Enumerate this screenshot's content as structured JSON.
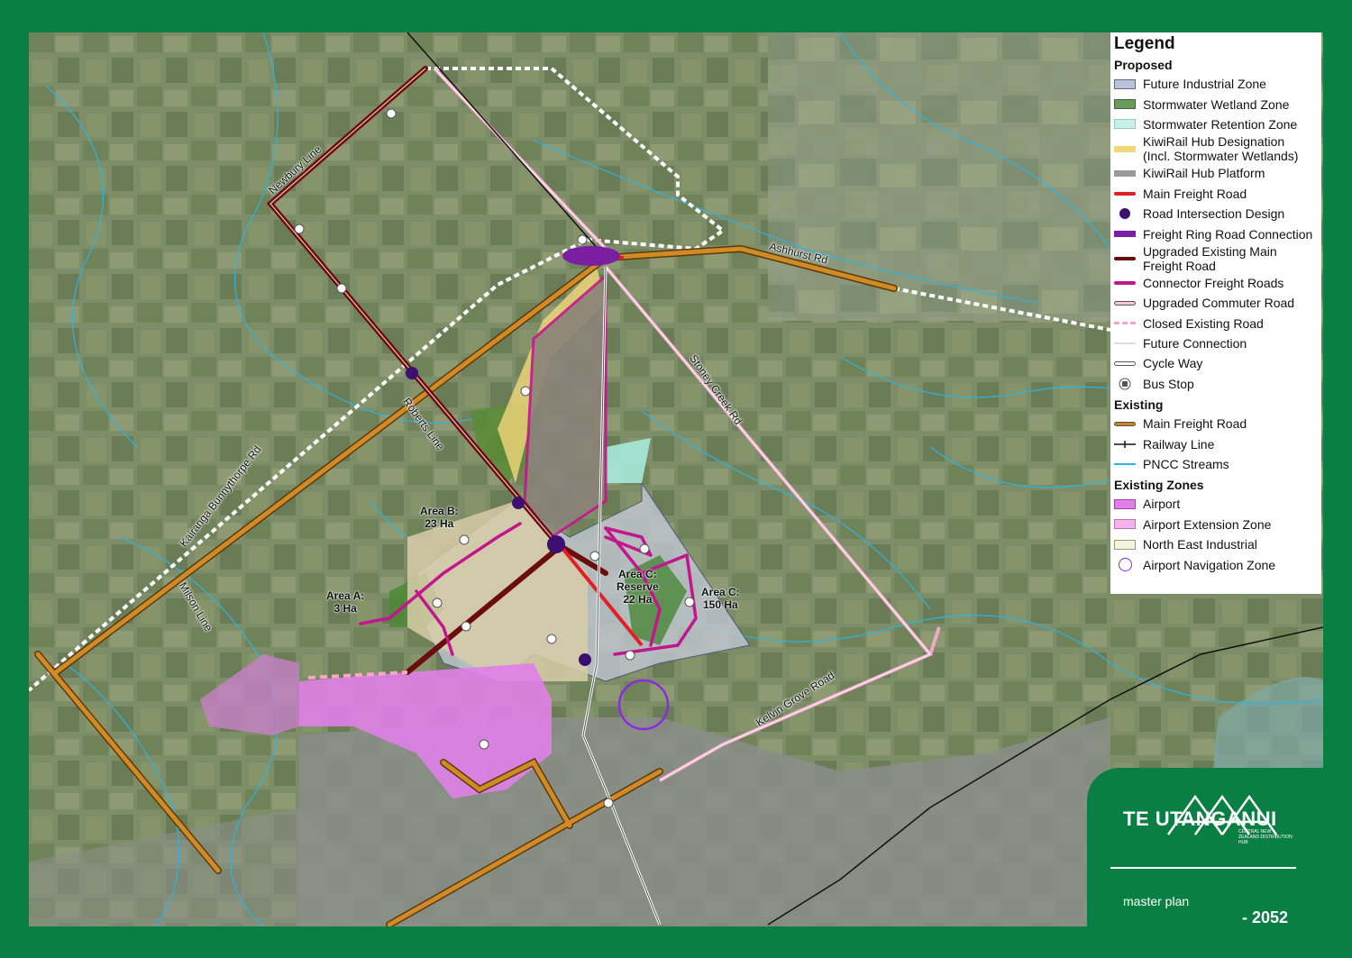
{
  "legend": {
    "title": "Legend",
    "sections": {
      "proposed": "Proposed",
      "existing": "Existing",
      "existing_zones": "Existing Zones"
    },
    "proposed_items": [
      {
        "label": "Future Industrial Zone",
        "icon": "box",
        "color": "#b9c4d9",
        "border": "#5a6a8a"
      },
      {
        "label": "Stormwater Wetland Zone",
        "icon": "box",
        "color": "#6a9a5a",
        "border": "#3a6a3a"
      },
      {
        "label": "Stormwater Retention Zone",
        "icon": "box",
        "color": "#c8f0ea",
        "border": "#8ad0c8"
      },
      {
        "label": "KiwiRail Hub Designation\n(Incl. Stormwater Wetlands)",
        "icon": "bar",
        "color": "#f2d77a"
      },
      {
        "label": "KiwiRail Hub Platform",
        "icon": "bar",
        "color": "#999999"
      },
      {
        "label": "Main Freight Road",
        "icon": "line",
        "color": "#e31e24"
      },
      {
        "label": "Road Intersection Design",
        "icon": "dot",
        "color": "#3b1070"
      },
      {
        "label": "Freight Ring Road Connection",
        "icon": "bar",
        "color": "#7b1fa2"
      },
      {
        "label": "Upgraded Existing Main\nFreight Road",
        "icon": "line",
        "color": "#6b0d0d"
      },
      {
        "label": "Connector Freight Roads",
        "icon": "line",
        "color": "#c4168c"
      },
      {
        "label": "Upgraded Commuter Road",
        "icon": "outline-line",
        "color": "#f7c6dd"
      },
      {
        "label": "Closed Existing Road",
        "icon": "dash",
        "color": "#f7a6c6"
      },
      {
        "label": "Future Connection",
        "icon": "thin-line",
        "color": "#dddddd"
      },
      {
        "label": "Cycle Way",
        "icon": "outline-line",
        "color": "#ffffff"
      },
      {
        "label": "Bus Stop",
        "icon": "bus-icon",
        "color": "#555555"
      }
    ],
    "existing_items": [
      {
        "label": "Main Freight Road",
        "icon": "outline-line",
        "color": "#c9861e"
      },
      {
        "label": "Railway Line",
        "icon": "rail",
        "color": "#111111"
      },
      {
        "label": "PNCC Streams",
        "icon": "thin-line",
        "color": "#29b6e8"
      }
    ],
    "existing_zone_items": [
      {
        "label": "Airport",
        "icon": "box",
        "color": "#e07fe8",
        "border": "#a040a8"
      },
      {
        "label": "Airport Extension Zone",
        "icon": "box",
        "color": "#f0b3ea",
        "border": "#c070b8"
      },
      {
        "label": "North East Industrial",
        "icon": "box",
        "color": "#f3f3de",
        "border": "#9a9a70"
      },
      {
        "label": "Airport Navigation Zone",
        "icon": "ring",
        "color": "#8a2be2"
      }
    ]
  },
  "map_labels": {
    "area_a": "Area A:\n3 Ha",
    "area_b": "Area B:\n23 Ha",
    "area_c_reserve": "Area C:\nReserve\n22 Ha",
    "area_c": "Area C:\n150 Ha"
  },
  "roads": {
    "newbury": "Newbury Line",
    "ashhurst": "Ashhurst Rd",
    "roberts": "Roberts Line",
    "stoney": "Stoney Creek Rd",
    "kairanga": "Kairanga Bunnythorpe Rd",
    "milson": "Milson Line",
    "kelvin": "Kelvin Grove Road"
  },
  "brand": {
    "logo": "TE UTANGANUI",
    "tagline": "CENTRAL NEW ZEALAND DISTRIBUTION HUB",
    "subtitle": "master plan",
    "year": "- 2052"
  },
  "colors": {
    "frame": "#0a7f43",
    "main_freight_existing": "#c9861e",
    "upgraded_main_freight": "#6b0d0d",
    "connector": "#c4168c",
    "airport": "#e07fe8",
    "stream": "#29b6e8"
  }
}
